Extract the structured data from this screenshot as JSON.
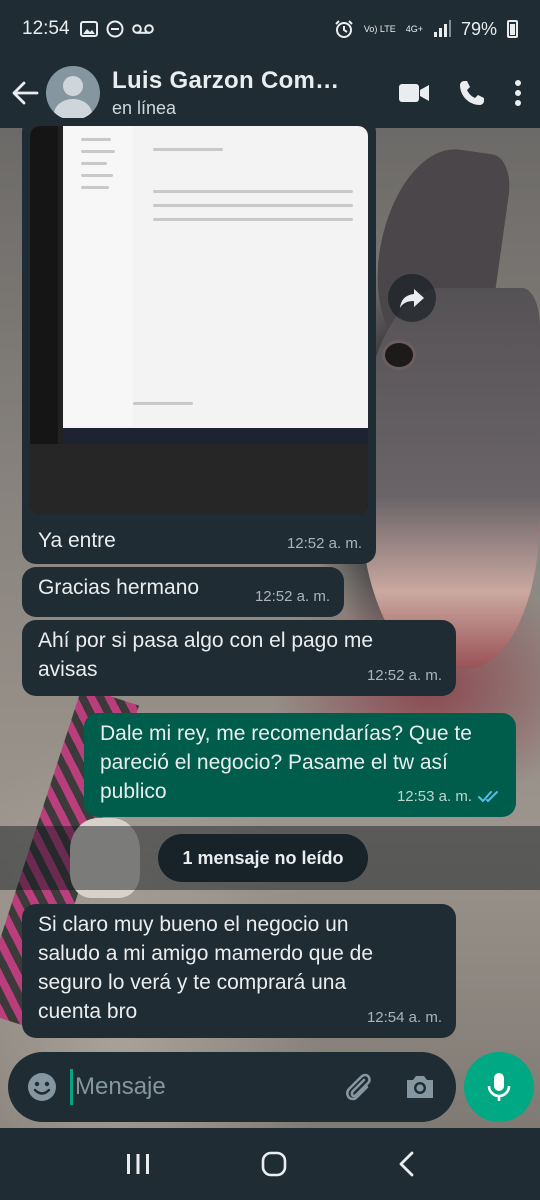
{
  "status_bar": {
    "time": "12:54",
    "network_label_top": "Vo) LTE",
    "network_label_mid": "4G+",
    "battery": "79%"
  },
  "header": {
    "contact_name": "Luis Garzon Com…",
    "contact_status": "en línea"
  },
  "messages": [
    {
      "direction": "in",
      "text": "Ya entre",
      "time": "12:52 a. m.",
      "has_image": true
    },
    {
      "direction": "in",
      "text": "Gracias hermano",
      "time": "12:52 a. m."
    },
    {
      "direction": "in",
      "text": "Ahí por si pasa algo con el pago me avisas",
      "time": "12:52 a. m."
    },
    {
      "direction": "out",
      "text": "Dale mi rey, me recomendarías? Que te pareció el negocio? Pasame el tw así publico",
      "time": "12:53 a. m.",
      "status": "read"
    },
    {
      "direction": "in",
      "text": "Si claro muy bueno el negocio un saludo a mi amigo mamerdo que de seguro lo verá y te comprará una cuenta bro",
      "time": "12:54 a. m."
    }
  ],
  "unread_divider": "1 mensaje no leído",
  "composer": {
    "placeholder": "Mensaje"
  },
  "colors": {
    "header_bg": "#1f2c34",
    "incoming_bubble": "#202c33",
    "outgoing_bubble": "#005c4b",
    "accent": "#00a884",
    "read_ticks": "#53bdeb"
  }
}
